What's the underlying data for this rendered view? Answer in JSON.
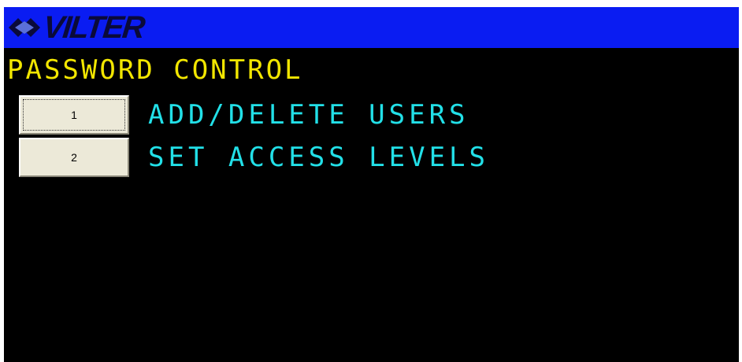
{
  "header": {
    "logo_text": "VILTER",
    "logo_icon": "vilter-diamond-logo",
    "background_color": "#0a1cf2"
  },
  "page": {
    "title": "PASSWORD CONTROL",
    "title_color": "#f2e600",
    "label_color": "#22e0e8",
    "background_color": "#000000"
  },
  "menu": {
    "items": [
      {
        "button_label": "1",
        "label": "ADD/DELETE USERS",
        "focused": true
      },
      {
        "button_label": "2",
        "label": "SET ACCESS LEVELS",
        "focused": false
      }
    ]
  }
}
